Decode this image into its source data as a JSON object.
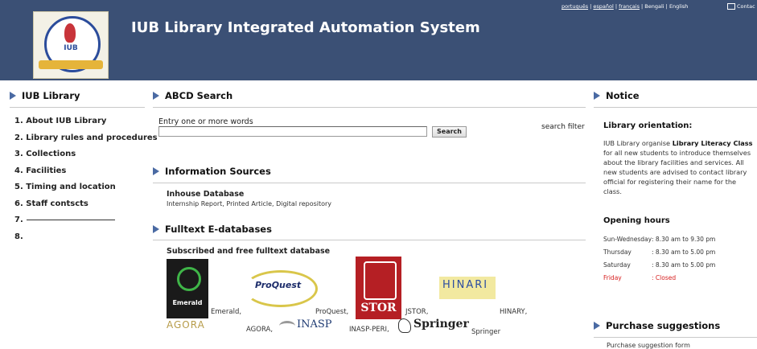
{
  "header": {
    "title": "IUB Library Integrated Automation System",
    "logo_text": "IUB",
    "languages": [
      "português",
      "español",
      "français",
      "Bengali",
      "English"
    ],
    "contact": "Contac"
  },
  "left": {
    "heading": "IUB Library",
    "items": [
      "1. About IUB Library",
      "2. Library rules and procedures",
      "3. Collections",
      "4. Facilities",
      "5. Timing and location",
      "6. Staff contscts",
      "7.",
      "8."
    ]
  },
  "search": {
    "heading": "ABCD Search",
    "label": "Entry one or more words",
    "value": "",
    "button": "Search",
    "filter": "search filter"
  },
  "info_sources": {
    "heading": "Information Sources",
    "sub": "Inhouse Database",
    "desc": "Internship Report, Printed Article, Digital repository"
  },
  "fulltext": {
    "heading": "Fulltext E-databases",
    "sub": "Subscribed and free fulltext database",
    "logos": {
      "emerald": "Emerald",
      "proquest": "ProQuest",
      "jstor": "STOR",
      "hinari": "HINARI",
      "agora": "AGORA",
      "inasp": "INASP",
      "springer": "Springer"
    },
    "captions": {
      "emerald": "Emerald,",
      "proquest": "ProQuest,",
      "jstor": "JSTOR,",
      "hinari": "HINARY,",
      "agora": "AGORA,",
      "inasp": "INASP-PERI,",
      "springer": "Springer"
    }
  },
  "notice": {
    "heading": "Notice",
    "orientation_heading": "Library orientation:",
    "orientation_pre": "IUB Library organise ",
    "orientation_bold": "Library Literacy Class",
    "orientation_post": " for all new students to introduce themselves about the library facilities and services. All new students are advised to contact library official for registering their name for the class.",
    "hours_heading": "Opening hours",
    "hours": [
      {
        "day": "Sun-Wednesday",
        "time": ": 8.30 am to 9.30 pm"
      },
      {
        "day": "Thursday",
        "time": ": 8.30 am to 5.00 pm"
      },
      {
        "day": "Saturday",
        "time": ": 8.30 am to 5.00 pm"
      },
      {
        "day": "Friday",
        "time": ": Closed"
      }
    ]
  },
  "purchase": {
    "heading": "Purchase suggestions",
    "form_link": "Purchase suggestion form"
  },
  "colors": {
    "header_bg": "#3b5075",
    "arrow": "#4a6aa3",
    "closed": "#d61c1c"
  }
}
